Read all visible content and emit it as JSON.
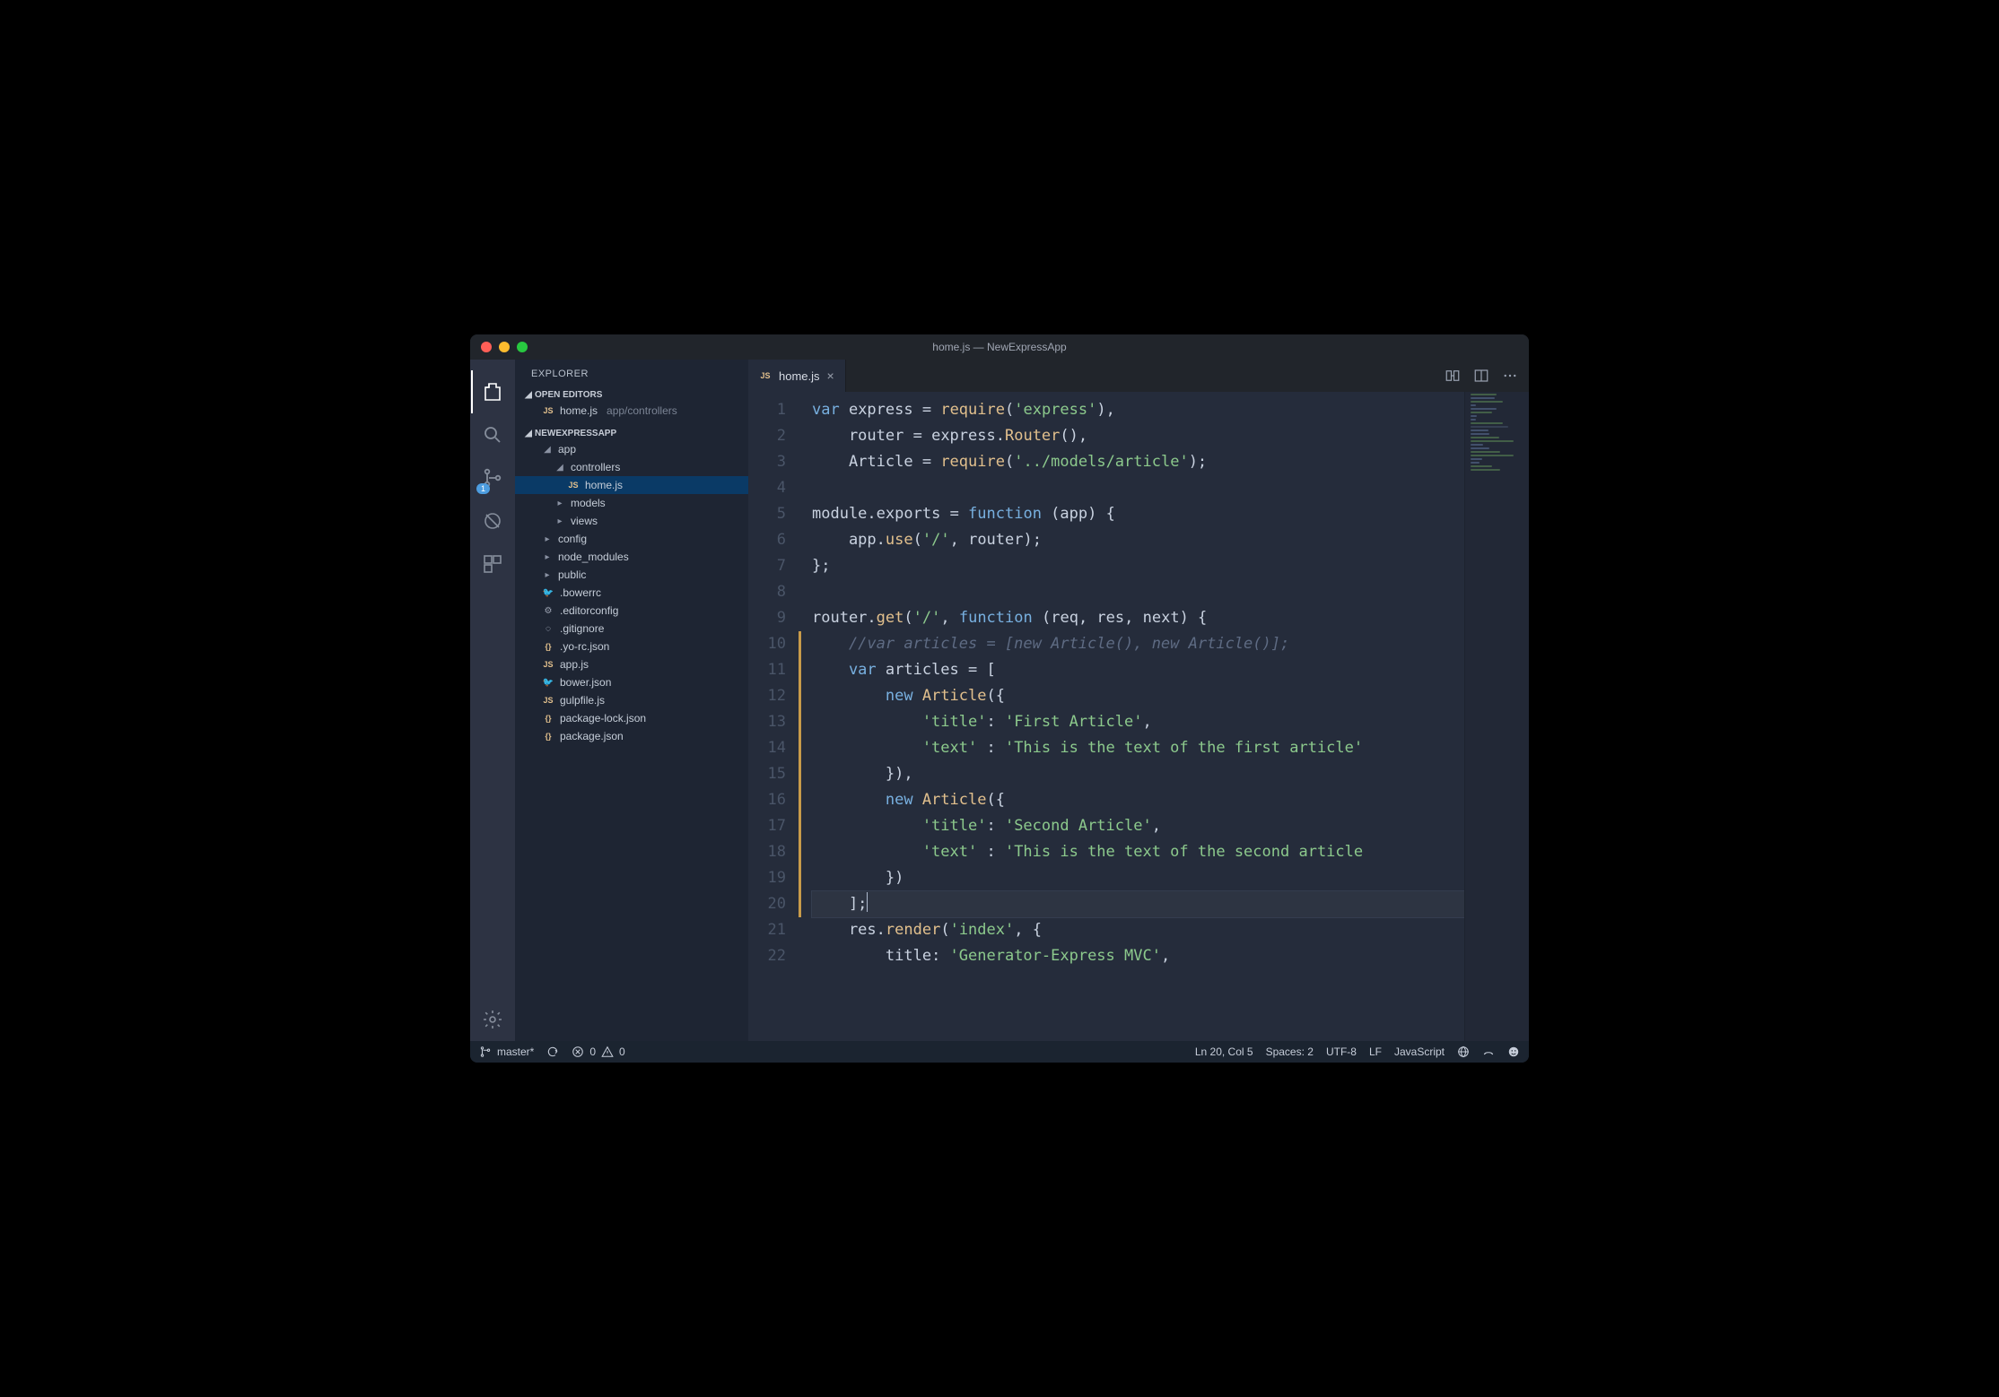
{
  "window": {
    "title": "home.js — NewExpressApp"
  },
  "sidebar": {
    "title": "EXPLORER",
    "sections": {
      "openEditors": {
        "label": "OPEN EDITORS",
        "items": [
          {
            "icon": "JS",
            "name": "home.js",
            "detail": "app/controllers"
          }
        ]
      },
      "project": {
        "label": "NEWEXPRESSAPP",
        "tree": [
          {
            "type": "folder",
            "open": true,
            "indent": 0,
            "name": "app"
          },
          {
            "type": "folder",
            "open": true,
            "indent": 1,
            "name": "controllers"
          },
          {
            "type": "file",
            "indent": 2,
            "icon": "JS",
            "name": "home.js",
            "selected": true
          },
          {
            "type": "folder",
            "open": false,
            "indent": 1,
            "name": "models"
          },
          {
            "type": "folder",
            "open": false,
            "indent": 1,
            "name": "views"
          },
          {
            "type": "folder",
            "open": false,
            "indent": 0,
            "name": "config"
          },
          {
            "type": "folder",
            "open": false,
            "indent": 0,
            "name": "node_modules"
          },
          {
            "type": "folder",
            "open": false,
            "indent": 0,
            "name": "public"
          },
          {
            "type": "file",
            "indent": 0,
            "icon": "bower",
            "name": ".bowerrc"
          },
          {
            "type": "file",
            "indent": 0,
            "icon": "gear",
            "name": ".editorconfig"
          },
          {
            "type": "file",
            "indent": 0,
            "icon": "git",
            "name": ".gitignore"
          },
          {
            "type": "file",
            "indent": 0,
            "icon": "{}",
            "name": ".yo-rc.json"
          },
          {
            "type": "file",
            "indent": 0,
            "icon": "JS",
            "name": "app.js"
          },
          {
            "type": "file",
            "indent": 0,
            "icon": "bower",
            "name": "bower.json"
          },
          {
            "type": "file",
            "indent": 0,
            "icon": "JS",
            "name": "gulpfile.js"
          },
          {
            "type": "file",
            "indent": 0,
            "icon": "{}",
            "name": "package-lock.json"
          },
          {
            "type": "file",
            "indent": 0,
            "icon": "{}",
            "name": "package.json"
          }
        ]
      }
    }
  },
  "scm_badge": "1",
  "editor": {
    "tab": {
      "icon": "JS",
      "name": "home.js"
    },
    "lines": [
      1,
      2,
      3,
      4,
      5,
      6,
      7,
      8,
      9,
      10,
      11,
      12,
      13,
      14,
      15,
      16,
      17,
      18,
      19,
      20,
      21,
      22
    ],
    "modified_from": 10,
    "modified_to": 20,
    "current_line": 20,
    "tokens_per_line": [
      [
        [
          "kw",
          "var"
        ],
        [
          "id",
          " express "
        ],
        [
          "op",
          "= "
        ],
        [
          "fn",
          "require"
        ],
        [
          "pn",
          "("
        ],
        [
          "str",
          "'express'"
        ],
        [
          "pn",
          "),"
        ]
      ],
      [
        [
          "id",
          "    router "
        ],
        [
          "op",
          "= "
        ],
        [
          "id",
          "express"
        ],
        [
          "pn",
          "."
        ],
        [
          "fn",
          "Router"
        ],
        [
          "pn",
          "(),"
        ]
      ],
      [
        [
          "id",
          "    Article "
        ],
        [
          "op",
          "= "
        ],
        [
          "fn",
          "require"
        ],
        [
          "pn",
          "("
        ],
        [
          "str",
          "'../models/article'"
        ],
        [
          "pn",
          ");"
        ]
      ],
      [],
      [
        [
          "id",
          "module"
        ],
        [
          "pn",
          "."
        ],
        [
          "id",
          "exports "
        ],
        [
          "op",
          "= "
        ],
        [
          "kw",
          "function"
        ],
        [
          "pn",
          " ("
        ],
        [
          "id",
          "app"
        ],
        [
          "pn",
          ") {"
        ]
      ],
      [
        [
          "id",
          "    app"
        ],
        [
          "pn",
          "."
        ],
        [
          "fn",
          "use"
        ],
        [
          "pn",
          "("
        ],
        [
          "str",
          "'/'"
        ],
        [
          "pn",
          ", "
        ],
        [
          "id",
          "router"
        ],
        [
          "pn",
          ");"
        ]
      ],
      [
        [
          "pn",
          "};"
        ]
      ],
      [],
      [
        [
          "id",
          "router"
        ],
        [
          "pn",
          "."
        ],
        [
          "fn",
          "get"
        ],
        [
          "pn",
          "("
        ],
        [
          "str",
          "'/'"
        ],
        [
          "pn",
          ", "
        ],
        [
          "kw",
          "function"
        ],
        [
          "pn",
          " ("
        ],
        [
          "id",
          "req"
        ],
        [
          "pn",
          ", "
        ],
        [
          "id",
          "res"
        ],
        [
          "pn",
          ", "
        ],
        [
          "id",
          "next"
        ],
        [
          "pn",
          ") {"
        ]
      ],
      [
        [
          "cm",
          "    //var articles = [new Article(), new Article()];"
        ]
      ],
      [
        [
          "kw",
          "    var"
        ],
        [
          "id",
          " articles "
        ],
        [
          "op",
          "= "
        ],
        [
          "pn",
          "["
        ]
      ],
      [
        [
          "kw",
          "        new"
        ],
        [
          "id",
          " "
        ],
        [
          "fn",
          "Article"
        ],
        [
          "pn",
          "({"
        ]
      ],
      [
        [
          "str",
          "            'title'"
        ],
        [
          "pn",
          ": "
        ],
        [
          "str",
          "'First Article'"
        ],
        [
          "pn",
          ","
        ]
      ],
      [
        [
          "str",
          "            'text'"
        ],
        [
          "pn",
          " : "
        ],
        [
          "str",
          "'This is the text of the first article'"
        ]
      ],
      [
        [
          "pn",
          "        }),"
        ]
      ],
      [
        [
          "kw",
          "        new"
        ],
        [
          "id",
          " "
        ],
        [
          "fn",
          "Article"
        ],
        [
          "pn",
          "({"
        ]
      ],
      [
        [
          "str",
          "            'title'"
        ],
        [
          "pn",
          ": "
        ],
        [
          "str",
          "'Second Article'"
        ],
        [
          "pn",
          ","
        ]
      ],
      [
        [
          "str",
          "            'text'"
        ],
        [
          "pn",
          " : "
        ],
        [
          "str",
          "'This is the text of the second article"
        ]
      ],
      [
        [
          "pn",
          "        })"
        ]
      ],
      [
        [
          "pn",
          "    ];"
        ]
      ],
      [
        [
          "id",
          "    res"
        ],
        [
          "pn",
          "."
        ],
        [
          "fn",
          "render"
        ],
        [
          "pn",
          "("
        ],
        [
          "str",
          "'index'"
        ],
        [
          "pn",
          ", {"
        ]
      ],
      [
        [
          "id",
          "        title"
        ],
        [
          "pn",
          ": "
        ],
        [
          "str",
          "'Generator-Express MVC'"
        ],
        [
          "pn",
          ","
        ]
      ]
    ]
  },
  "status": {
    "branch": "master*",
    "errors": "0",
    "warnings": "0",
    "position": "Ln 20, Col 5",
    "spaces": "Spaces: 2",
    "encoding": "UTF-8",
    "eol": "LF",
    "language": "JavaScript"
  }
}
